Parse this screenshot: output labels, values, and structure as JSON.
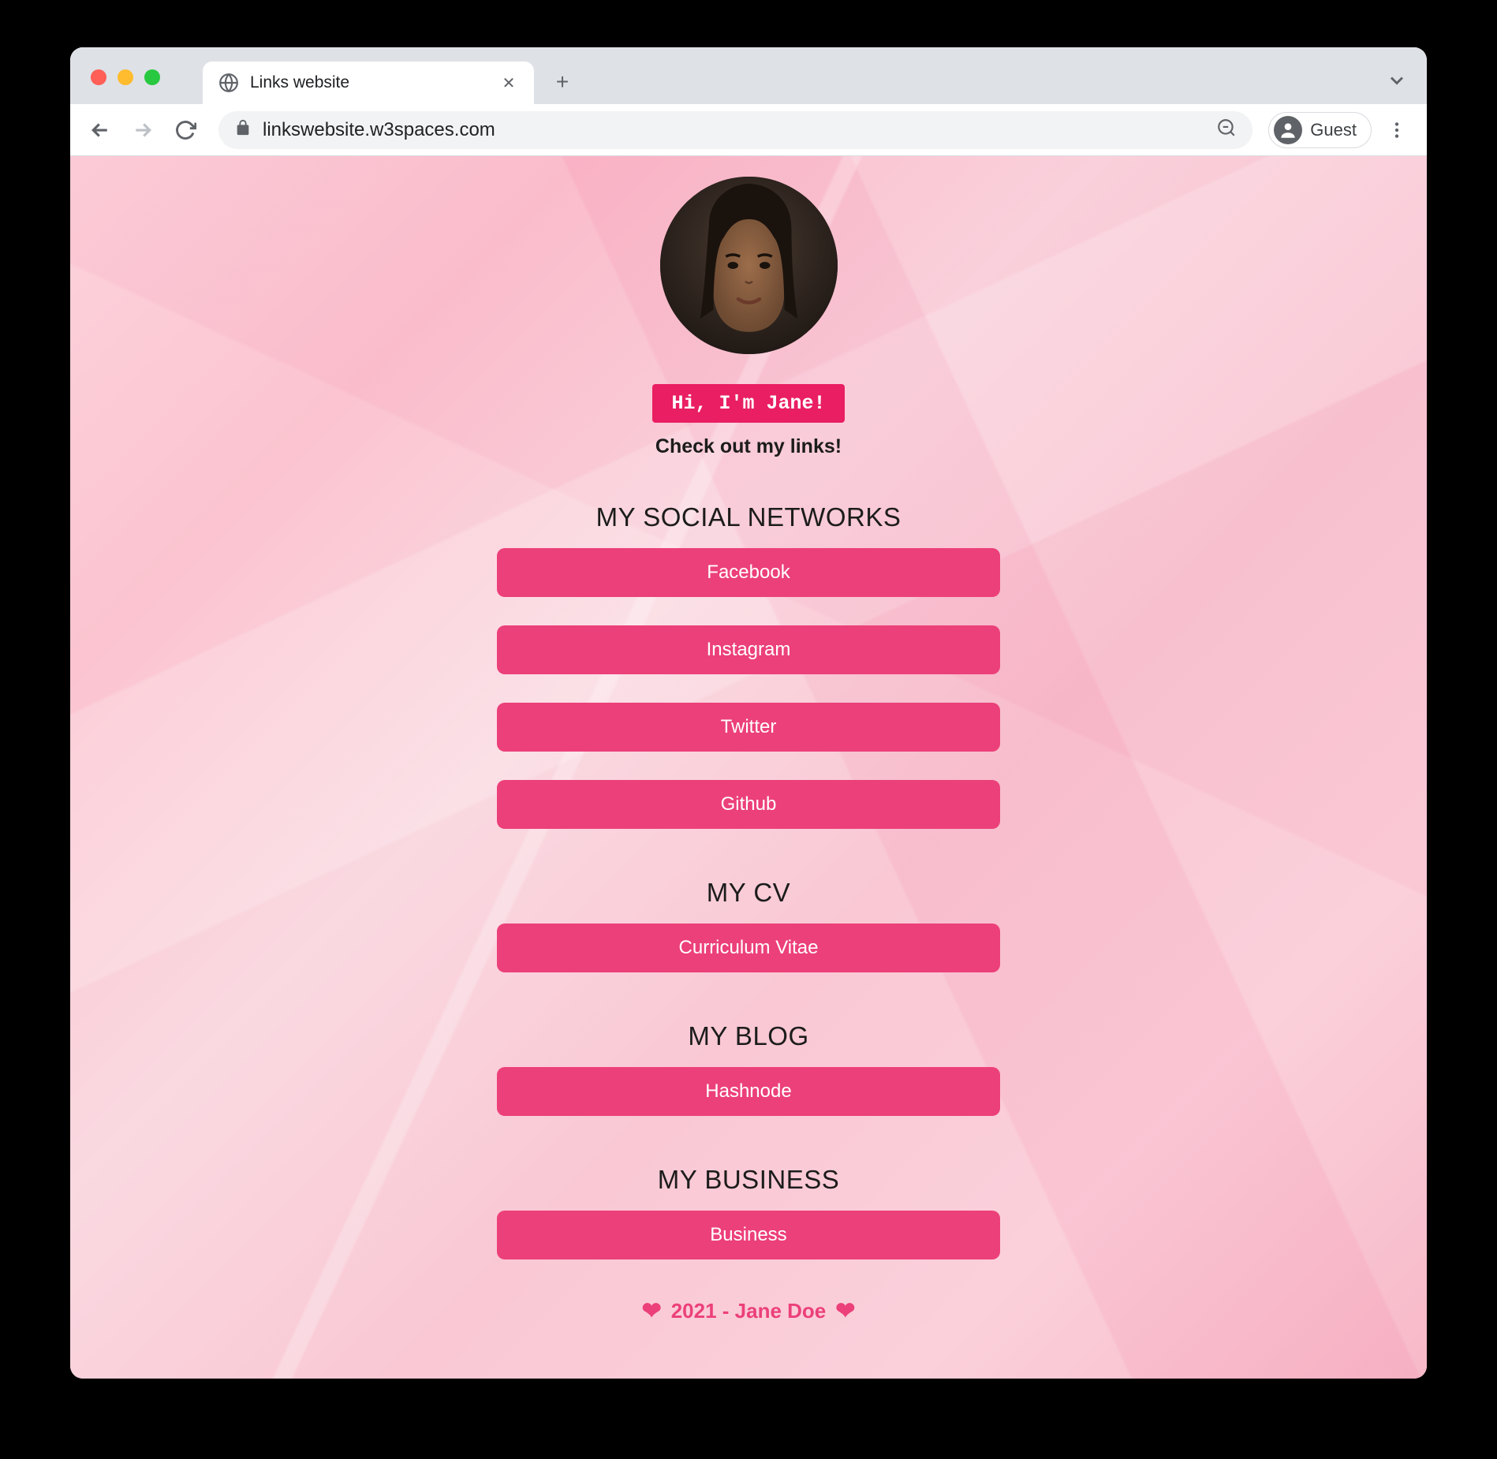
{
  "browser": {
    "tab_title": "Links website",
    "url": "linkswebsite.w3spaces.com",
    "profile_label": "Guest"
  },
  "profile": {
    "greeting": "Hi, I'm Jane!",
    "subtitle": "Check out my links!"
  },
  "sections": [
    {
      "title": "MY SOCIAL NETWORKS",
      "links": [
        "Facebook",
        "Instagram",
        "Twitter",
        "Github"
      ]
    },
    {
      "title": "MY CV",
      "links": [
        "Curriculum Vitae"
      ]
    },
    {
      "title": "MY BLOG",
      "links": [
        "Hashnode"
      ]
    },
    {
      "title": "MY BUSINESS",
      "links": [
        "Business"
      ]
    }
  ],
  "footer": {
    "text": "2021 - Jane Doe"
  }
}
